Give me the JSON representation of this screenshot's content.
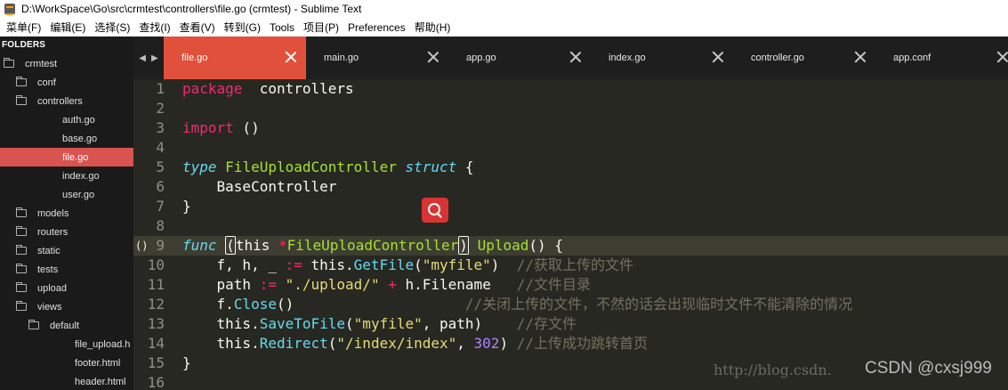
{
  "window": {
    "title": "D:\\WorkSpace\\Go\\src\\crmtest\\controllers\\file.go (crmtest) - Sublime Text"
  },
  "menu": [
    "菜单(F)",
    "编辑(E)",
    "选择(S)",
    "查找(I)",
    "查看(V)",
    "转到(G)",
    "Tools",
    "项目(P)",
    "Preferences",
    "帮助(H)"
  ],
  "sidebar": {
    "title": "FOLDERS",
    "items": [
      {
        "label": "crmtest",
        "type": "folder"
      },
      {
        "label": "conf",
        "type": "folder"
      },
      {
        "label": "controllers",
        "type": "folder"
      },
      {
        "label": "auth.go",
        "type": "file"
      },
      {
        "label": "base.go",
        "type": "file"
      },
      {
        "label": "file.go",
        "type": "file",
        "selected": true
      },
      {
        "label": "index.go",
        "type": "file"
      },
      {
        "label": "user.go",
        "type": "file"
      },
      {
        "label": "models",
        "type": "folder"
      },
      {
        "label": "routers",
        "type": "folder"
      },
      {
        "label": "static",
        "type": "folder"
      },
      {
        "label": "tests",
        "type": "folder"
      },
      {
        "label": "upload",
        "type": "folder"
      },
      {
        "label": "views",
        "type": "folder"
      },
      {
        "label": "default",
        "type": "folder"
      },
      {
        "label": "file_upload.h",
        "type": "file"
      },
      {
        "label": "footer.html",
        "type": "file"
      },
      {
        "label": "header.html",
        "type": "file"
      }
    ]
  },
  "tabs": [
    {
      "label": "file.go",
      "active": true
    },
    {
      "label": "main.go"
    },
    {
      "label": "app.go"
    },
    {
      "label": "index.go"
    },
    {
      "label": "controller.go"
    },
    {
      "label": "app.conf"
    }
  ],
  "editor": {
    "current_line": 9,
    "lines": [
      {
        "n": "1",
        "tokens": [
          [
            "kw",
            "package"
          ],
          [
            "",
            "  controllers"
          ]
        ]
      },
      {
        "n": "2",
        "tokens": []
      },
      {
        "n": "3",
        "tokens": [
          [
            "kw",
            "import"
          ],
          [
            "",
            " ()"
          ]
        ]
      },
      {
        "n": "4",
        "tokens": []
      },
      {
        "n": "5",
        "tokens": [
          [
            "ty",
            "type"
          ],
          [
            "",
            " "
          ],
          [
            "fn",
            "FileUploadController"
          ],
          [
            "",
            " "
          ],
          [
            "ty",
            "struct"
          ],
          [
            "",
            " {"
          ]
        ]
      },
      {
        "n": "6",
        "tokens": [
          [
            "",
            "    BaseController"
          ]
        ]
      },
      {
        "n": "7",
        "tokens": [
          [
            "",
            "}"
          ]
        ]
      },
      {
        "n": "8",
        "tokens": []
      },
      {
        "n": "9",
        "tokens": [
          [
            "ty",
            "func"
          ],
          [
            "",
            " "
          ],
          [
            "hl",
            "("
          ],
          [
            "",
            "this "
          ],
          [
            "kw",
            "*"
          ],
          [
            "fn",
            "FileUploadController"
          ],
          [
            "hl",
            ")"
          ],
          [
            "",
            " "
          ],
          [
            "fn",
            "Upload"
          ],
          [
            "",
            "() {"
          ]
        ]
      },
      {
        "n": "10",
        "tokens": [
          [
            "",
            "    f, h, _ "
          ],
          [
            "kw",
            ":="
          ],
          [
            "",
            " this."
          ],
          [
            "meth",
            "GetFile"
          ],
          [
            "",
            "("
          ],
          [
            "str",
            "\"myfile\""
          ],
          [
            "",
            ")  "
          ],
          [
            "cm",
            "//获取上传的文件"
          ]
        ]
      },
      {
        "n": "11",
        "tokens": [
          [
            "",
            "    path "
          ],
          [
            "kw",
            ":="
          ],
          [
            "",
            " "
          ],
          [
            "str",
            "\"./upload/\""
          ],
          [
            "",
            " "
          ],
          [
            "kw",
            "+"
          ],
          [
            "",
            " h.Filename   "
          ],
          [
            "cm",
            "//文件目录"
          ]
        ]
      },
      {
        "n": "12",
        "tokens": [
          [
            "",
            "    f."
          ],
          [
            "meth",
            "Close"
          ],
          [
            "",
            "()                    "
          ],
          [
            "cm",
            "//关闭上传的文件，不然的话会出现临时文件不能清除的情况"
          ]
        ]
      },
      {
        "n": "13",
        "tokens": [
          [
            "",
            "    this."
          ],
          [
            "meth",
            "SaveToFile"
          ],
          [
            "",
            "("
          ],
          [
            "str",
            "\"myfile\""
          ],
          [
            "",
            ", path)    "
          ],
          [
            "cm",
            "//存文件"
          ]
        ]
      },
      {
        "n": "14",
        "tokens": [
          [
            "",
            "    this."
          ],
          [
            "meth",
            "Redirect"
          ],
          [
            "",
            "("
          ],
          [
            "str",
            "\"/index/index\""
          ],
          [
            "",
            ", "
          ],
          [
            "num",
            "302"
          ],
          [
            "",
            ") "
          ],
          [
            "cm",
            "//上传成功跳转首页"
          ]
        ]
      },
      {
        "n": "15",
        "tokens": [
          [
            "",
            "}"
          ]
        ]
      },
      {
        "n": "16",
        "tokens": []
      }
    ]
  },
  "fold_marker": "()",
  "watermark": {
    "url": "http://blog.csdn.",
    "brand": "CSDN @cxsj999"
  },
  "colors": {
    "accent": "#e0503a",
    "background": "#272822",
    "sidebar": "#1a1a1a"
  },
  "icons": [
    "sublime-text-icon",
    "folder-icon",
    "tab-close-icon",
    "search-icon"
  ]
}
